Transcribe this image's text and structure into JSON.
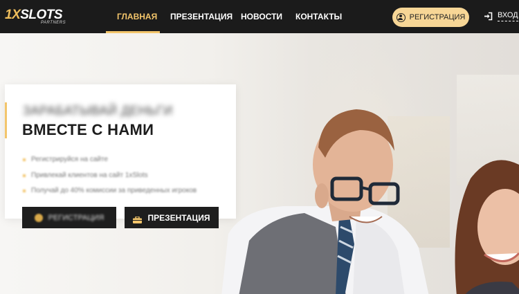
{
  "header": {
    "logo": {
      "main_prefix": "1X",
      "main_rest": "SLOTS",
      "sub": "PARTNERS"
    },
    "nav": [
      {
        "label": "ГЛАВНАЯ",
        "active": true
      },
      {
        "label": "ПРЕЗЕНТАЦИЯ",
        "active": false
      },
      {
        "label": "НОВОСТИ",
        "active": false
      },
      {
        "label": "КОНТАКТЫ",
        "active": false
      }
    ],
    "register_label": "РЕГИСТРАЦИЯ",
    "login_label": "ВХОД",
    "register_icon": "user-circle-icon",
    "login_icon": "sign-in-icon"
  },
  "hero": {
    "blurred_heading": "ЗАРАБАТЫВАЙ ДЕНЬГИ",
    "title": "ВМЕСТЕ С НАМИ",
    "bullets": [
      "Регистрируйся на сайте",
      "Привлекай клиентов на сайт 1xSlots",
      "Получай до 40% комиссии за приведенных игроков"
    ],
    "register_button_label": "РЕГИСТРАЦИЯ",
    "presentation_button_label": "ПРЕЗЕНТАЦИЯ",
    "presentation_icon": "briefcase-icon",
    "register_icon": "coin-icon"
  },
  "colors": {
    "accent": "#f3c56b",
    "header_bg": "#1b1b1b",
    "button_bg": "#1e1e1e",
    "register_pill": "#f7d696"
  }
}
